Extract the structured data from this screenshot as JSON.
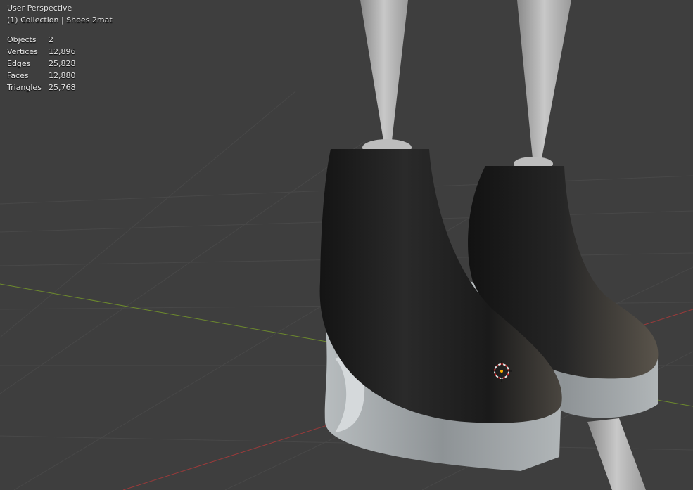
{
  "viewport": {
    "view_name": "User Perspective",
    "context": "(1) Collection | Shoes 2mat",
    "stats": [
      {
        "label": "Objects",
        "value": "2"
      },
      {
        "label": "Vertices",
        "value": "12,896"
      },
      {
        "label": "Edges",
        "value": "25,828"
      },
      {
        "label": "Faces",
        "value": "12,880"
      },
      {
        "label": "Triangles",
        "value": "25,768"
      }
    ]
  },
  "colors": {
    "background": "#3e3e3e",
    "grid_line": "#4a4a4a",
    "x_axis": "#9b3a3a",
    "y_axis": "#6d8a2d",
    "shoe_upper": "#1c1c1c",
    "sole": "#a8adaf"
  }
}
